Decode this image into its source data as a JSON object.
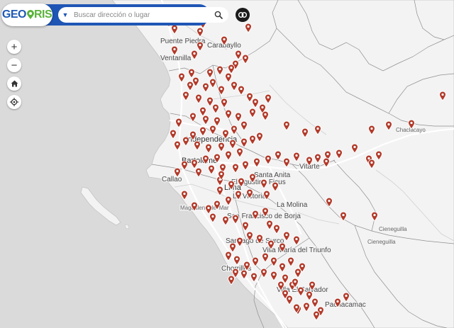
{
  "app": {
    "logo_part1": "GEO",
    "logo_part2": "RIS"
  },
  "search": {
    "placeholder": "Buscar dirección o lugar"
  },
  "controls": [
    {
      "name": "zoom-in-button",
      "icon": "plus-icon",
      "glyph": "+"
    },
    {
      "name": "zoom-out-button",
      "icon": "minus-icon",
      "glyph": "−"
    },
    {
      "name": "home-button",
      "icon": "home-icon",
      "glyph": ""
    },
    {
      "name": "locate-button",
      "icon": "crosshair-icon",
      "glyph": ""
    }
  ],
  "map": {
    "colors": {
      "ocean": "#d9d9d9",
      "land": "#f4f4f4",
      "marker": "#b23a2a",
      "boundary": "#8a8a8a",
      "road": "#ffffff"
    },
    "place_labels": [
      "Puente Piedra",
      "Carabayllo",
      "Ventanilla",
      "Independencia",
      "Bartolomé",
      "Chaclacayo",
      "Santa Anita",
      "Vitarte",
      "Callao",
      "El Agustino Ficus",
      "Lima",
      "La Victoria",
      "Magdalena del Mar",
      "La Molina",
      "San Francisco de Borja",
      "Cieneguilla",
      "Cieneguilla",
      "Santiago de Surco",
      "Villa María del Triunfo",
      "Chorrillos",
      "Villa El Salvador",
      "Pachacamac"
    ]
  }
}
